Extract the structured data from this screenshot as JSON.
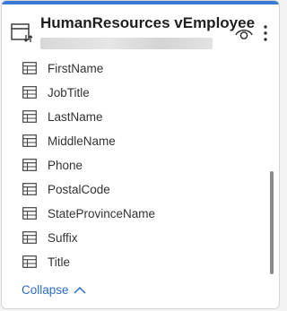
{
  "header": {
    "title": "HumanResources vEmployee",
    "table_icon": "table-refresh-icon",
    "eye_icon": "eye-icon",
    "more_icon": "more-vertical-icon"
  },
  "fields": [
    {
      "label": "FirstName",
      "icon": "table-icon"
    },
    {
      "label": "JobTitle",
      "icon": "table-icon"
    },
    {
      "label": "LastName",
      "icon": "table-icon"
    },
    {
      "label": "MiddleName",
      "icon": "table-icon"
    },
    {
      "label": "Phone",
      "icon": "table-icon"
    },
    {
      "label": "PostalCode",
      "icon": "table-icon"
    },
    {
      "label": "StateProvinceName",
      "icon": "table-icon"
    },
    {
      "label": "Suffix",
      "icon": "table-icon"
    },
    {
      "label": "Title",
      "icon": "table-icon"
    }
  ],
  "footer": {
    "collapse_label": "Collapse",
    "collapse_icon": "chevron-up-icon"
  },
  "colors": {
    "accent": "#3b7bd6",
    "link": "#2b6cc4",
    "text": "#333333"
  }
}
